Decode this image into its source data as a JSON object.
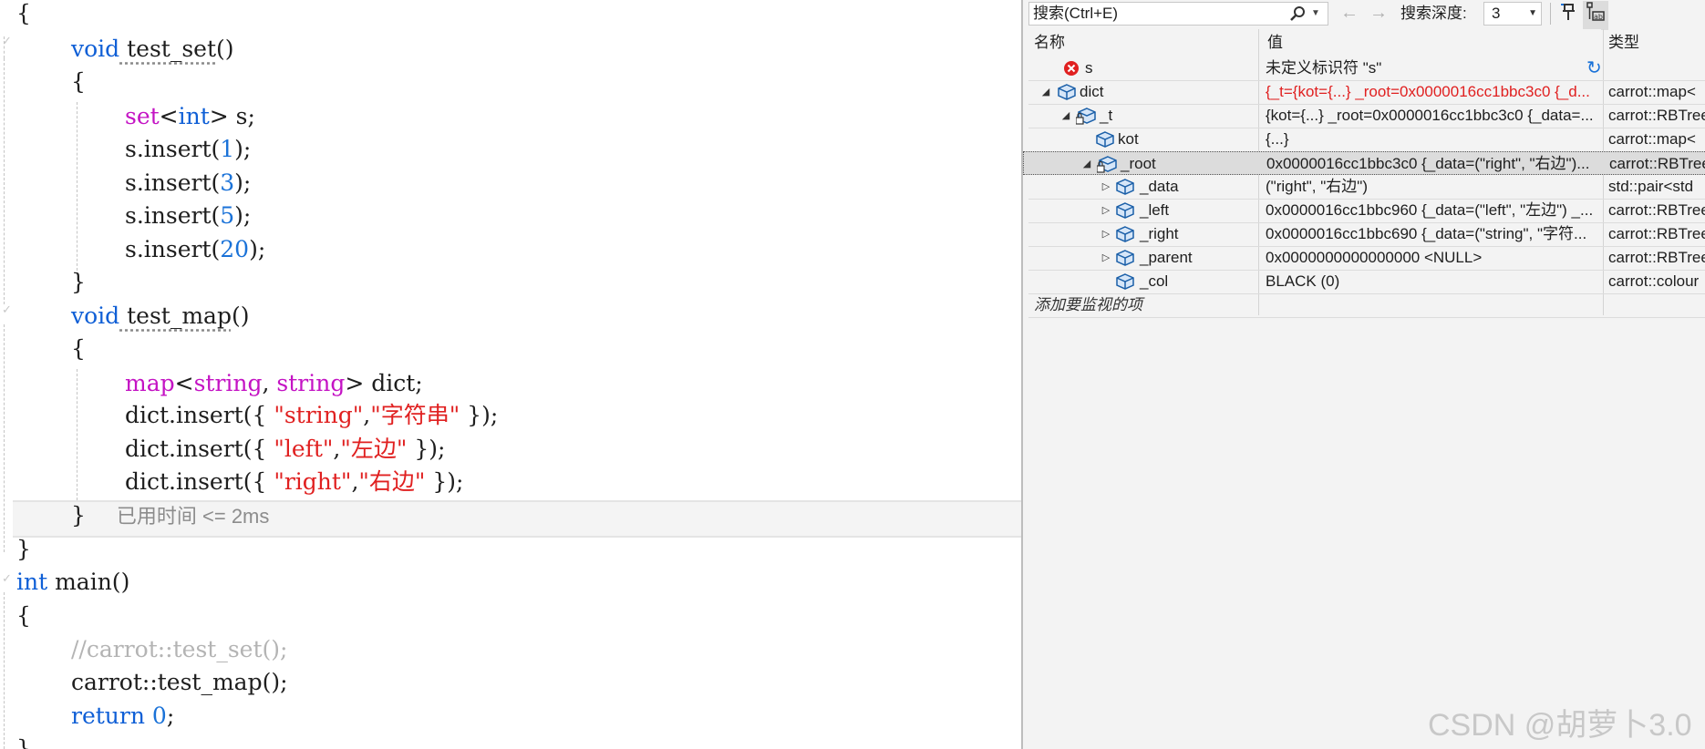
{
  "editor": {
    "lines": [
      "{",
      "void",
      " test_set",
      "()",
      "{",
      "set",
      "<",
      "int",
      "> s;",
      "s.insert(",
      "1",
      ");",
      "s.insert(",
      "3",
      ");",
      "s.insert(",
      "5",
      ");",
      "s.insert(",
      "20",
      ");",
      "}",
      "void",
      " test_map",
      "()",
      "{",
      "map",
      "<",
      "string",
      ", ",
      "string",
      "> dict;",
      "dict.insert({ ",
      "\"string\"",
      ",",
      "\"字符串\"",
      " });",
      "dict.insert({ ",
      "\"left\"",
      ",",
      "\"左边\"",
      " });",
      "dict.insert({ ",
      "\"right\"",
      ",",
      "\"右边\"",
      " });",
      "}",
      "已用时间 <= 2ms",
      "}",
      "int",
      " main()",
      "{",
      "//carrot::test_set();",
      "carrot::test_map();",
      "return",
      " ",
      "0",
      ";",
      "}"
    ]
  },
  "watch": {
    "search_placeholder": "搜索(Ctrl+E)",
    "depth_label": "搜索深度:",
    "depth_value": "3",
    "columns": {
      "name": "名称",
      "value": "值",
      "type": "类型"
    },
    "rows": [
      {
        "name": "s",
        "value": "未定义标识符 \"s\"",
        "type": ""
      },
      {
        "name": "dict",
        "value": "{_t={kot={...} _root=0x0000016cc1bbc3c0 {_d...",
        "type": "carrot::map<"
      },
      {
        "name": "_t",
        "value": "{kot={...} _root=0x0000016cc1bbc3c0 {_data=...",
        "type": "carrot::RBTree"
      },
      {
        "name": "kot",
        "value": "{...}",
        "type": "carrot::map<"
      },
      {
        "name": "_root",
        "value": "0x0000016cc1bbc3c0 {_data=(\"right\", \"右边\")...",
        "type": "carrot::RBTree"
      },
      {
        "name": "_data",
        "value": "(\"right\", \"右边\")",
        "type": "std::pair<std"
      },
      {
        "name": "_left",
        "value": "0x0000016cc1bbc960 {_data=(\"left\", \"左边\") _...",
        "type": "carrot::RBTree"
      },
      {
        "name": "_right",
        "value": "0x0000016cc1bbc690 {_data=(\"string\", \"字符...",
        "type": "carrot::RBTree"
      },
      {
        "name": "_parent",
        "value": "0x0000000000000000 <NULL>",
        "type": "carrot::RBTree"
      },
      {
        "name": "_col",
        "value": "BLACK (0)",
        "type": "carrot::colour"
      }
    ],
    "add_item": "添加要监视的项"
  },
  "watermark": "CSDN @胡萝卜3.0",
  "colors": {
    "keyword": "#0f5fd6",
    "type": "#c413c4",
    "string": "#e02020",
    "number": "#1a72d8",
    "comment": "#b4b4b4",
    "error": "#e02020"
  }
}
